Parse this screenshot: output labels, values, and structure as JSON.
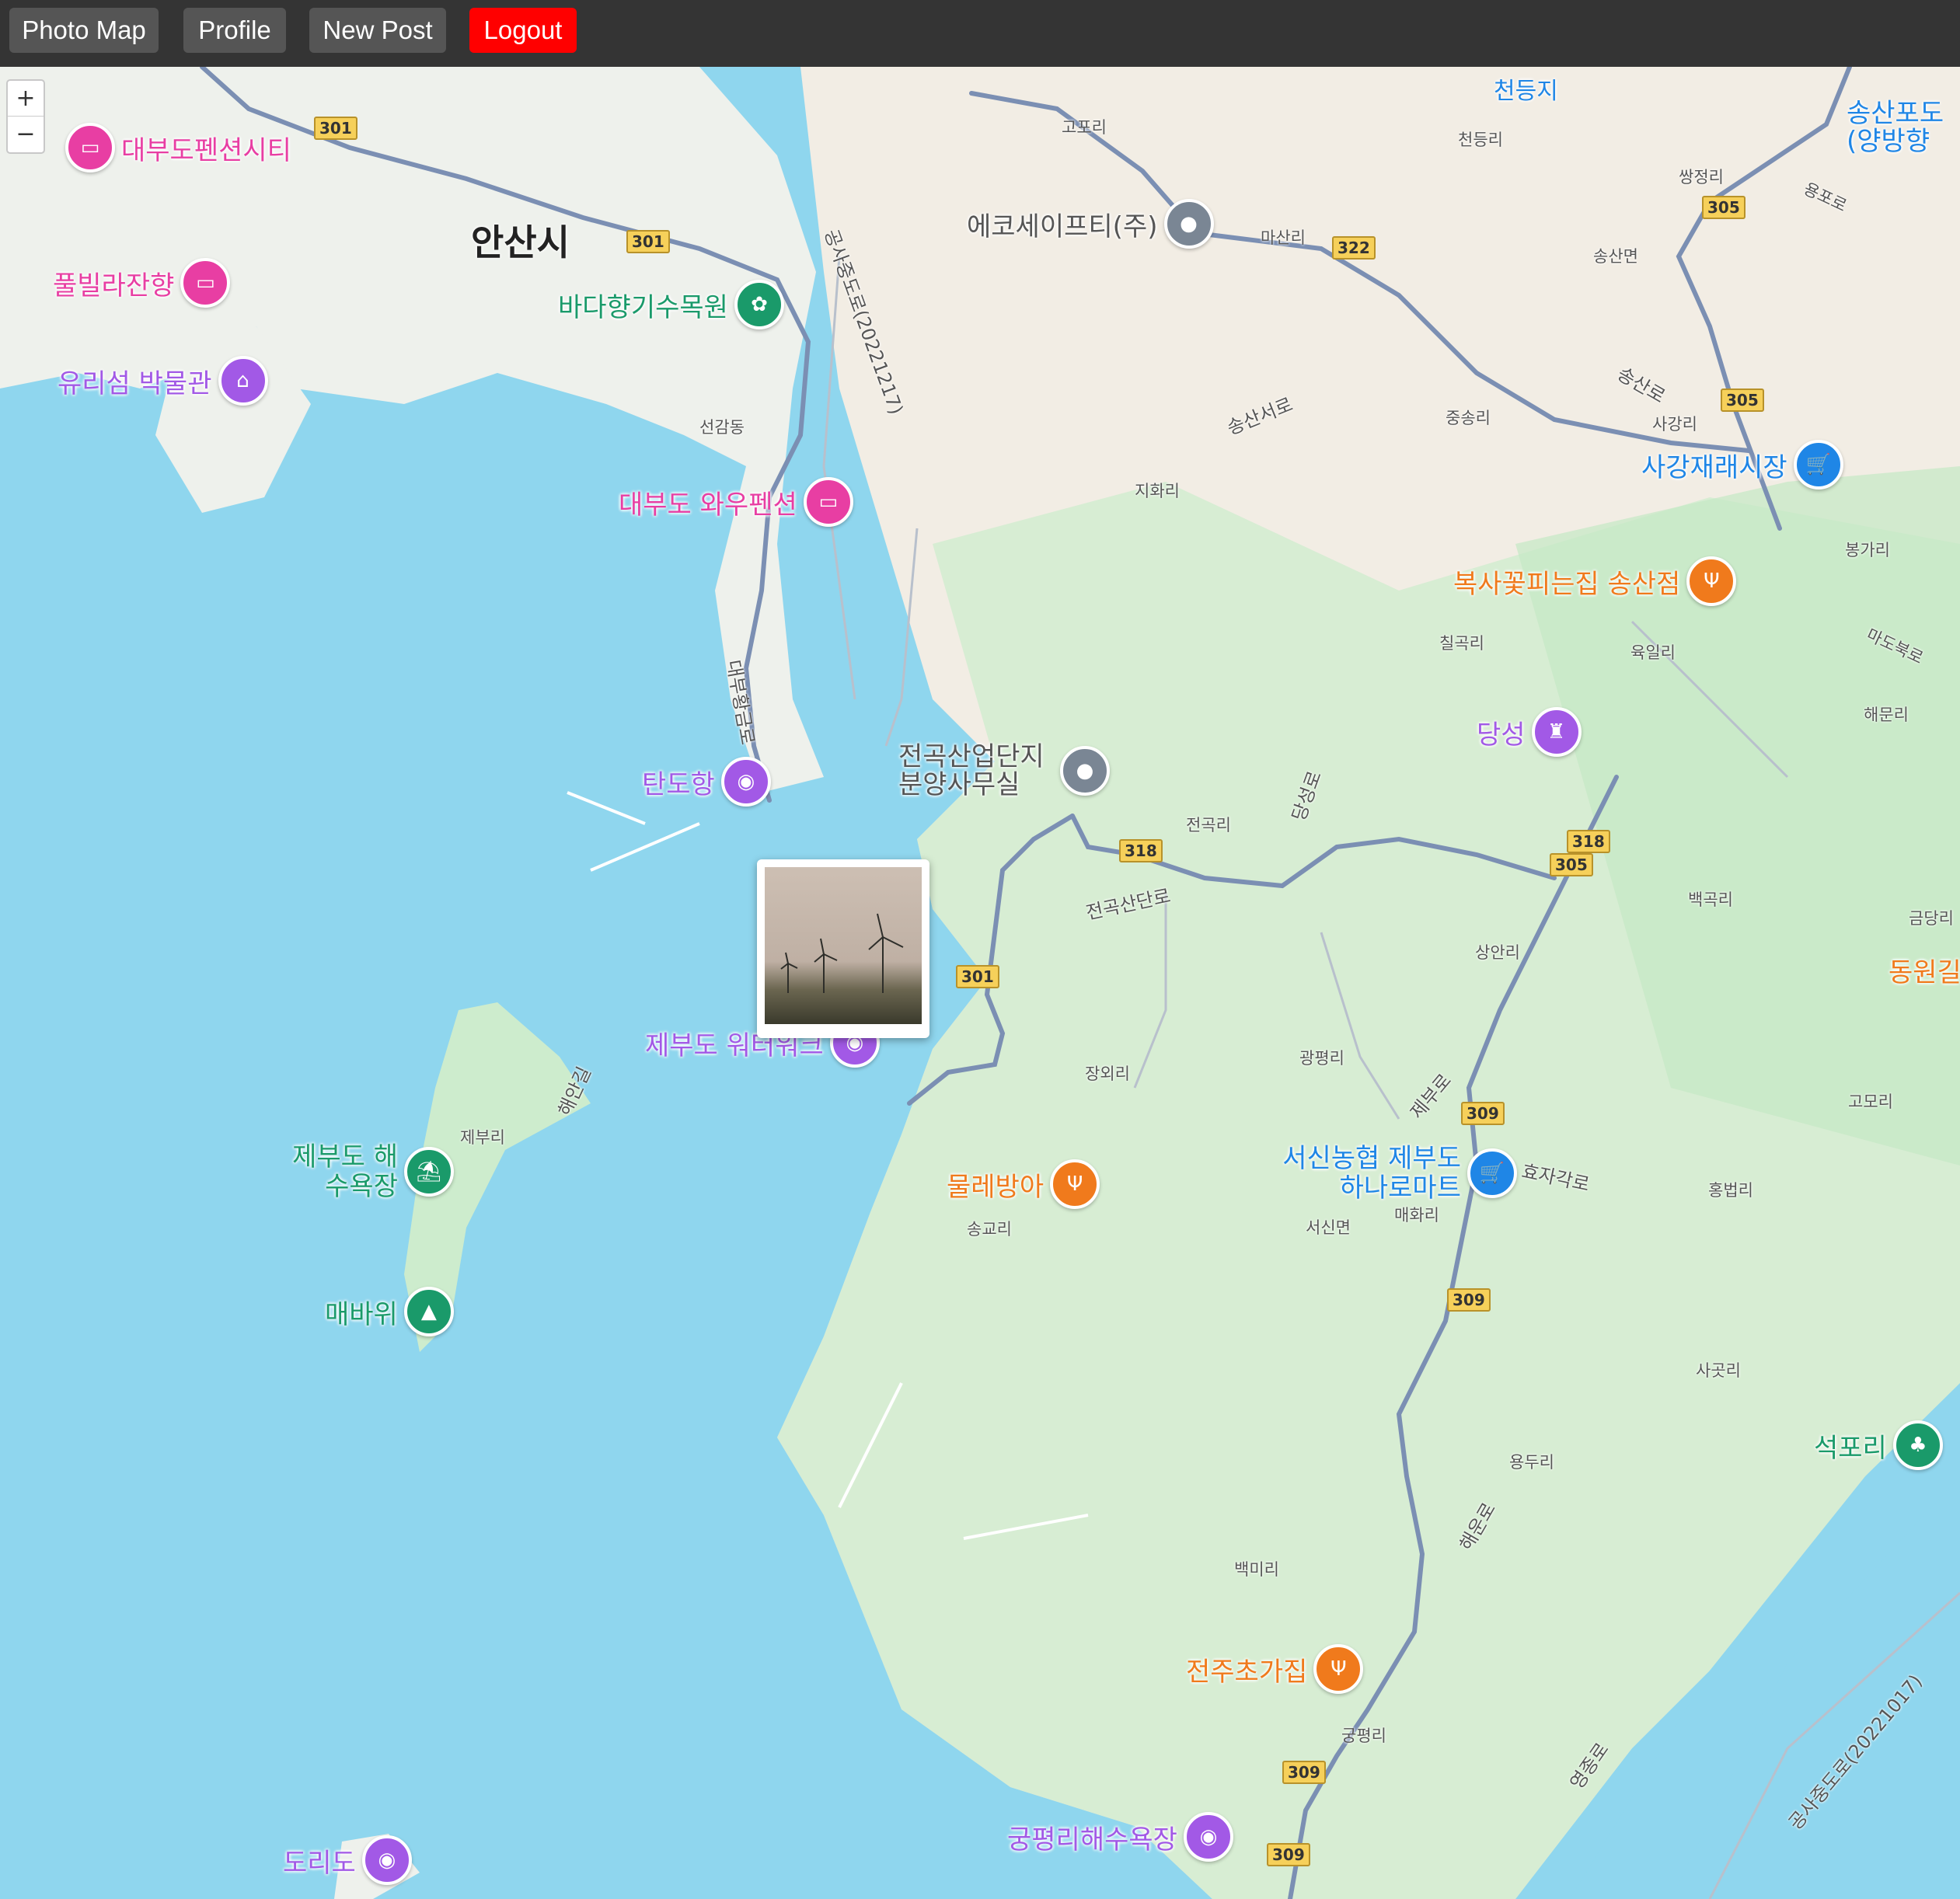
{
  "nav": {
    "photo_map": "Photo Map",
    "profile": "Profile",
    "new_post": "New Post",
    "logout": "Logout",
    "logout_color": "#ff0000"
  },
  "zoom": {
    "in": "+",
    "out": "−"
  },
  "city": "안산시",
  "pois": [
    {
      "name": "대부도펜션시티",
      "color": "#e83ea3",
      "icon": "bed-icon"
    },
    {
      "name": "풀빌라잔향",
      "color": "#e83ea3",
      "icon": "bed-icon"
    },
    {
      "name": "유리섬 박물관",
      "color": "#a259e6",
      "icon": "museum-icon"
    },
    {
      "name": "바다향기수목원",
      "color": "#1a9a6a",
      "icon": "flower-icon"
    },
    {
      "name": "대부도 와우펜션",
      "color": "#e83ea3",
      "icon": "bed-icon"
    },
    {
      "name": "탄도항",
      "color": "#a259e6",
      "icon": "camera-icon"
    },
    {
      "name": "에코세이프티(주)",
      "color": "#7a8694",
      "icon": "location-icon"
    },
    {
      "name": "전곡산업단지 분양사무실",
      "color": "#7a8694",
      "icon": "location-icon"
    },
    {
      "name": "제부도 워터워크",
      "color": "#a259e6",
      "icon": "camera-icon"
    },
    {
      "name": "제부도 해수욕장",
      "color": "#1a9a6a",
      "icon": "beach-icon"
    },
    {
      "name": "매바위",
      "color": "#1a9a6a",
      "icon": "tree-icon"
    },
    {
      "name": "도리도",
      "color": "#a259e6",
      "icon": "camera-icon"
    },
    {
      "name": "물레방아",
      "color": "#f07a1c",
      "icon": "restaurant-icon"
    },
    {
      "name": "서신농협 제부도 하나로마트",
      "color": "#1f86e6",
      "icon": "cart-icon"
    },
    {
      "name": "사강재래시장",
      "color": "#1f86e6",
      "icon": "cart-icon"
    },
    {
      "name": "복사꽃피는집 송산점",
      "color": "#f07a1c",
      "icon": "restaurant-icon"
    },
    {
      "name": "당성",
      "color": "#a259e6",
      "icon": "castle-icon"
    },
    {
      "name": "석포리",
      "color": "#1a9a6a",
      "icon": "park-icon"
    },
    {
      "name": "전주초가집",
      "color": "#f07a1c",
      "icon": "restaurant-icon"
    },
    {
      "name": "궁평리해수욕장",
      "color": "#a259e6",
      "icon": "camera-icon"
    },
    {
      "name": "송산포도 (양방향",
      "color": "#1f86e6",
      "icon": "none"
    },
    {
      "name": "천등지",
      "color": "#1f86e6",
      "icon": "none"
    },
    {
      "name": "동원길",
      "color": "#f07a1c",
      "icon": "none"
    }
  ],
  "places": [
    "고포리",
    "천등리",
    "쌍정리",
    "용포로",
    "송산면",
    "마산리",
    "송산서로",
    "중송리",
    "사강리",
    "지화리",
    "봉가리",
    "칠곡리",
    "육일리",
    "선감동",
    "해문리",
    "마도북로",
    "전곡리",
    "백곡리",
    "금당리",
    "상안리",
    "광평리",
    "장외리",
    "제부리",
    "고모리",
    "홍법리",
    "매화리",
    "서신면",
    "송교리",
    "사곳리",
    "용두리",
    "백미리",
    "궁평리",
    "효자각로",
    "전곡산단로",
    "송산로",
    "제부로",
    "해운로",
    "영종로",
    "당성로",
    "해안길",
    "대부황금로",
    "공사중도로(20221217)",
    "공사중도로(20221017)"
  ],
  "routes": [
    "301",
    "301",
    "322",
    "305",
    "305",
    "318",
    "318",
    "305",
    "301",
    "309",
    "309",
    "309",
    "309"
  ],
  "photo": {
    "alt": "wind turbines at dusk"
  }
}
